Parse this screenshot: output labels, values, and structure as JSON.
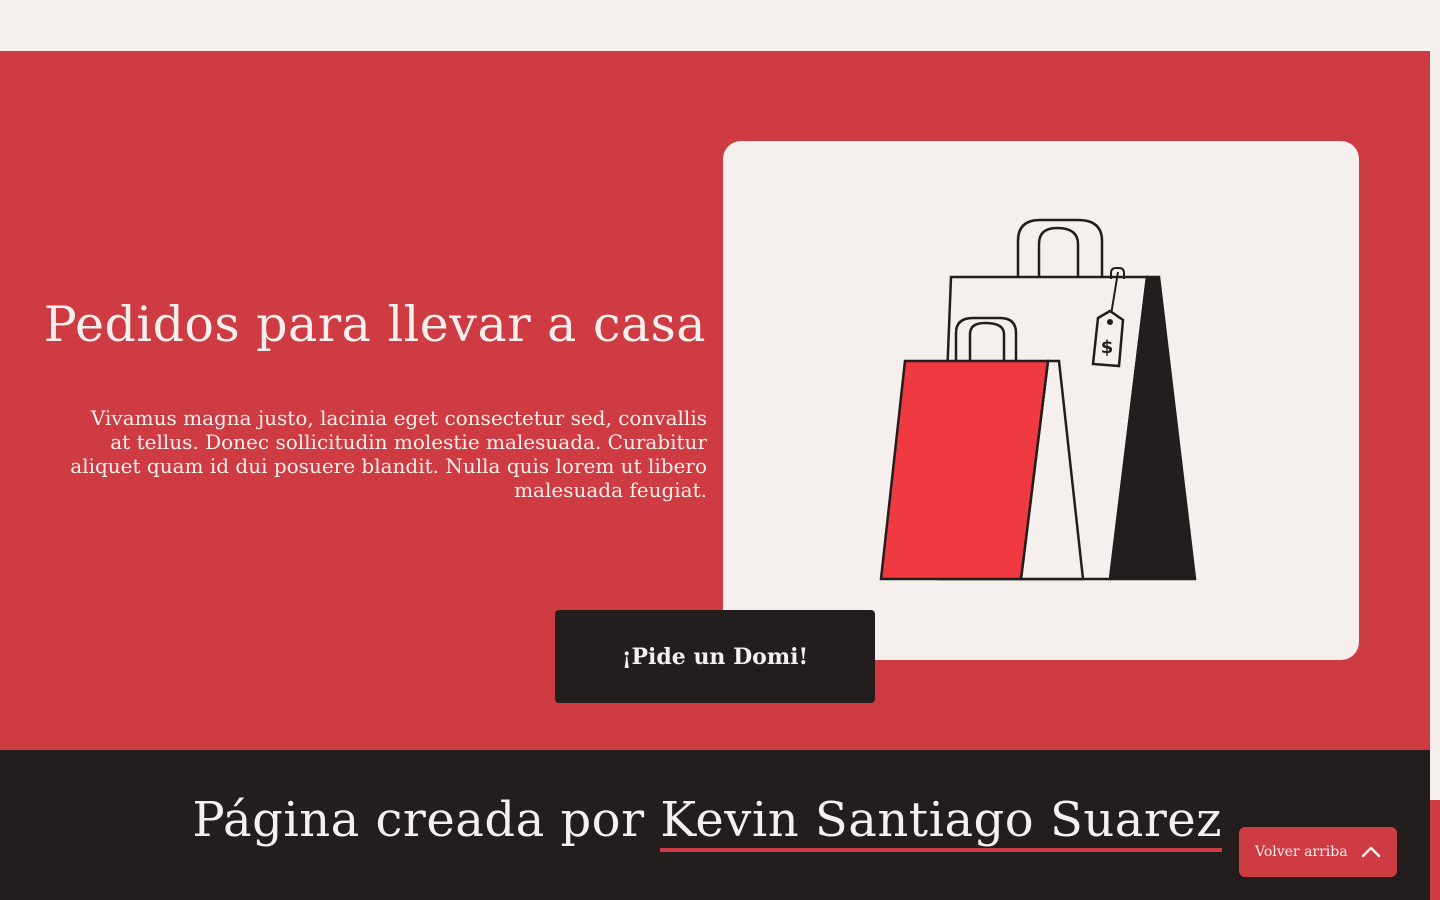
{
  "hero": {
    "title": "Pedidos para llevar a casa",
    "text": "Vivamus magna justo, lacinia eget consectetur sed, convallis at tellus. Donec sollicitudin molestie malesuada. Curabitur aliquet quam id dui posuere blandit. Nulla quis lorem ut libero malesuada feugiat.",
    "image_icon": "shopping-bags-illustration",
    "price_tag_symbol": "$",
    "cta_label": "¡Pide un Domi!"
  },
  "footer": {
    "prefix": "Página creada por ",
    "author": "Kevin Santiago Suarez"
  },
  "back_to_top": {
    "label": "Volver arriba",
    "icon": "chevron-up-icon"
  },
  "colors": {
    "brand_red": "#cf3b42",
    "dark": "#231d1d",
    "cream": "#f5f0ed",
    "bag_red": "#ee3a40"
  }
}
